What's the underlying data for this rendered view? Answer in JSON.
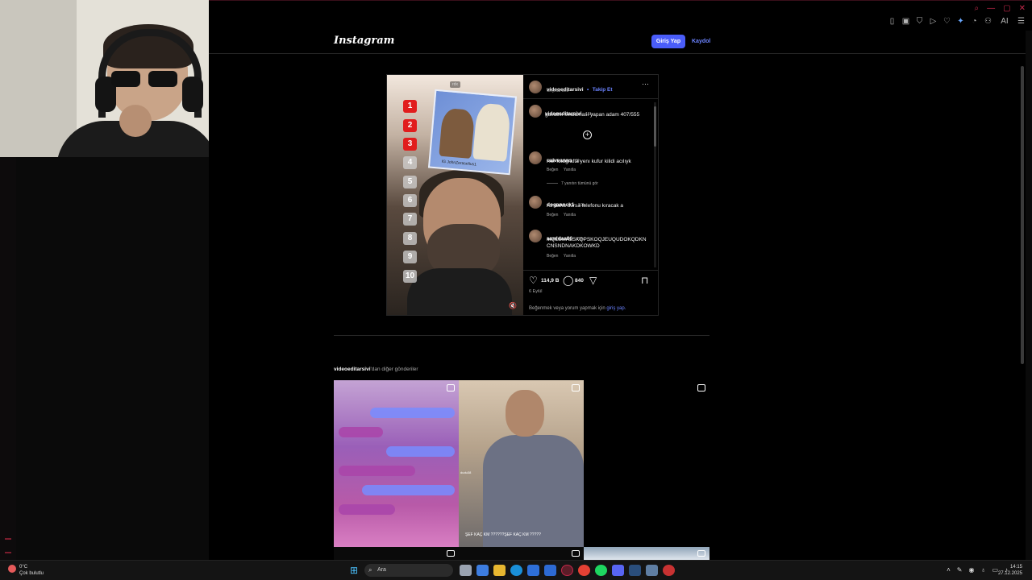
{
  "browser": {
    "toolbar_icons": [
      "bookmark-icon",
      "tab-icon",
      "shield-icon",
      "play-icon",
      "heart-icon",
      "extension-icon",
      "chat-icon",
      "user-icon",
      "ai-icon",
      "menu-icon"
    ],
    "ai_label": "AI"
  },
  "instagram": {
    "logo": "Instagram",
    "login_label": "Giriş Yap",
    "signup_label": "Kaydol"
  },
  "post": {
    "author": "videoeditarsivi",
    "follow_label": "Takip Et",
    "separator": "•",
    "audio": "Orijinal ses",
    "more_label": "···",
    "watermark": "rdx",
    "sticker_caption": "IG JohnZeraselius1",
    "ranks": [
      "1",
      "2",
      "3",
      "4",
      "5",
      "6",
      "7",
      "8",
      "9",
      "10"
    ],
    "caption": {
      "user": "videoeditarsivi",
      "time": "15h",
      "text": "gavatlık sıralaması yapan adam 407/555"
    },
    "comments": [
      {
        "user": "calveanns",
        "time": "9h",
        "text": "Her fotografta yenı kufur kilidi acılıyk",
        "like_label": "Beğen",
        "reply_label": "Yanıtla"
      },
      {
        "user": "dogannck1",
        "time": "10h",
        "text": "Az daha dursa telefonu kıracak a",
        "like_label": "Beğen",
        "reply_label": "Yanıtla"
      },
      {
        "user": "aarddaa06",
        "time": "10h",
        "text": "MQLSMALSKQPSKOQJEUQUDOKQDKNCNSNDNAKDKOWKD",
        "like_label": "Beğen",
        "reply_label": "Yanıtla"
      }
    ],
    "view_replies": "7 yanıtın tümünü gör",
    "likes": "114,9 B",
    "comment_count": "840",
    "date": "6 Eylül",
    "login_prompt_prefix": "Beğenmek veya yorum yapmak için",
    "login_prompt_link": "giriş yap."
  },
  "more_posts": {
    "user": "videoeditarsivi",
    "suffix": "'dan diğer gönderiler",
    "tile2_caption": "ŞEF KAÇ KM ??????ŞEF KAÇ KM ?????",
    "tile2_tag": "dudu38"
  },
  "taskbar": {
    "weather_temp": "0°C",
    "weather_desc": "Çok bulutlu",
    "search_placeholder": "Ara",
    "time": "14:15",
    "date": "27.12.2025"
  },
  "colors": {
    "accent": "#4a5df9",
    "link": "#6b83ff",
    "rank_red": "#e11d1d",
    "background": "#000000"
  }
}
